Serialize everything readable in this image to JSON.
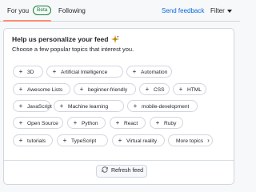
{
  "nav": {
    "tabs": [
      {
        "label": "For you",
        "badge": "Beta",
        "active": true
      },
      {
        "label": "Following"
      }
    ],
    "send_feedback": "Send feedback",
    "filter": "Filter"
  },
  "card": {
    "title": "Help us personalize your feed",
    "subtitle": "Choose a few popular topics that interest you.",
    "topics": [
      "3D",
      "Artificial Intelligence",
      "Automation",
      "Awesome Lists",
      "beginner-friendly",
      "CSS",
      "HTML",
      "JavaScript",
      "Machine learning",
      "mobile-development",
      "Open Source",
      "Python",
      "React",
      "Ruby",
      "tutorials",
      "TypeScript",
      "Virtual reality"
    ],
    "more_topics": "More topics",
    "refresh": "Refresh feed"
  },
  "colors": {
    "accent_underline": "#fd8c73",
    "link": "#0969da",
    "beta_badge": "#1a7f37"
  },
  "icons": {
    "chip": "plus-icon",
    "more": "chevron-right-icon",
    "filter": "triangle-down-icon",
    "title": "sparkle-icon",
    "refresh": "sync-icon"
  }
}
